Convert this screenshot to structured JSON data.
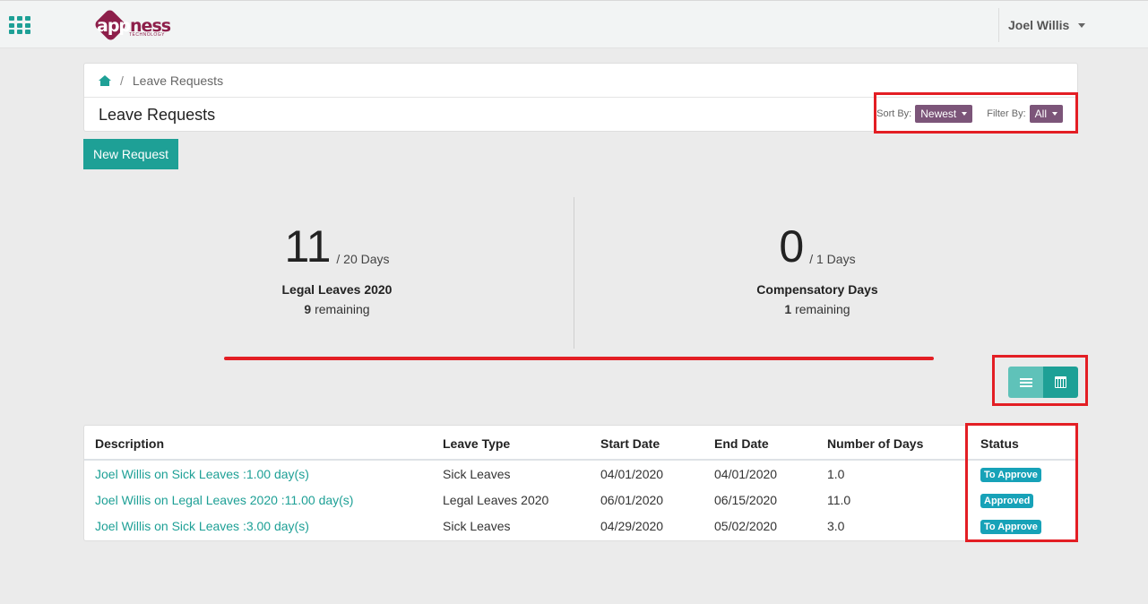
{
  "topbar": {
    "logo_text_1": "app",
    "logo_text_2": "ness",
    "logo_sub": "TECHNOLOGY",
    "user_name": "Joel Willis"
  },
  "breadcrumb": {
    "current": "Leave Requests"
  },
  "header": {
    "title": "Leave Requests",
    "sort_label": "Sort By:",
    "sort_value": "Newest",
    "filter_label": "Filter By:",
    "filter_value": "All"
  },
  "new_request_label": "New Request",
  "stats": [
    {
      "taken": "11",
      "total": "/ 20 Days",
      "label": "Legal Leaves 2020",
      "remaining_count": "9",
      "remaining_text": " remaining"
    },
    {
      "taken": "0",
      "total": "/ 1 Days",
      "label": "Compensatory Days",
      "remaining_count": "1",
      "remaining_text": " remaining"
    }
  ],
  "table": {
    "headers": [
      "Description",
      "Leave Type",
      "Start Date",
      "End Date",
      "Number of Days",
      "Status"
    ],
    "rows": [
      {
        "description": "Joel Willis on Sick Leaves :1.00 day(s)",
        "type": "Sick Leaves",
        "start": "04/01/2020",
        "end": "04/01/2020",
        "days": "1.0",
        "status": "To Approve"
      },
      {
        "description": "Joel Willis on Legal Leaves 2020 :11.00 day(s)",
        "type": "Legal Leaves 2020",
        "start": "06/01/2020",
        "end": "06/15/2020",
        "days": "11.0",
        "status": "Approved"
      },
      {
        "description": "Joel Willis on Sick Leaves :3.00 day(s)",
        "type": "Sick Leaves",
        "start": "04/29/2020",
        "end": "05/02/2020",
        "days": "3.0",
        "status": "To Approve"
      }
    ]
  },
  "colors": {
    "accent": "#1ea096",
    "brand": "#8d1f4a",
    "dropdown": "#7c5579",
    "badge": "#17a2b8",
    "annotation": "#e31e24"
  },
  "icons": [
    "apps-grid-icon",
    "home-icon",
    "list-view-icon",
    "calendar-view-icon"
  ]
}
